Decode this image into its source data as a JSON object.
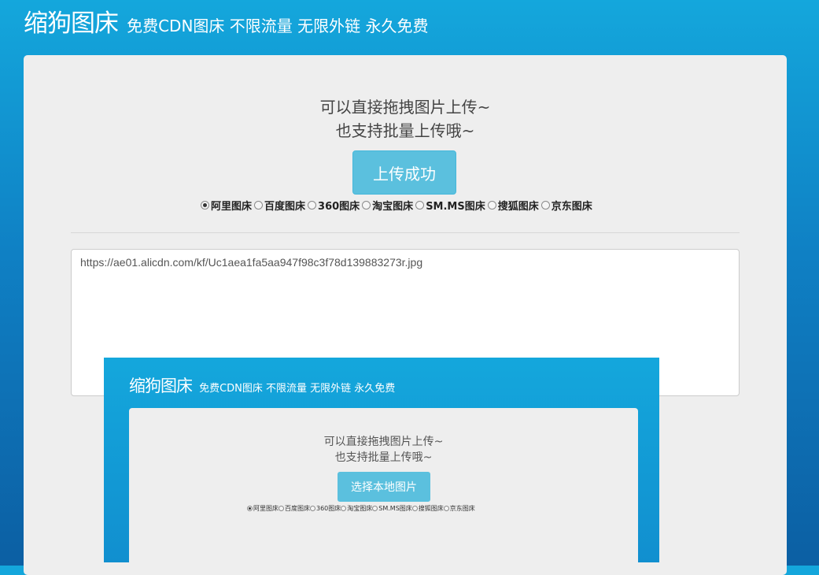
{
  "header": {
    "title": "缩狗图床",
    "subtitle": "免费CDN图床 不限流量 无限外链 永久免费"
  },
  "upload": {
    "hint_line1": "可以直接拖拽图片上传~",
    "hint_line2": "也支持批量上传哦~",
    "button_label": "上传成功"
  },
  "hosts": [
    {
      "label": "阿里图床",
      "checked": true
    },
    {
      "label": "百度图床",
      "checked": false
    },
    {
      "label": "360图床",
      "checked": false
    },
    {
      "label": "淘宝图床",
      "checked": false
    },
    {
      "label": "SM.MS图床",
      "checked": false
    },
    {
      "label": "搜狐图床",
      "checked": false
    },
    {
      "label": "京东图床",
      "checked": false
    }
  ],
  "result": {
    "url": "https://ae01.alicdn.com/kf/Uc1aea1fa5aa947f98c3f78d139883273r.jpg"
  },
  "preview": {
    "title": "缩狗图床",
    "subtitle": "免费CDN图床 不限流量 无限外链 永久免费",
    "hint_line1": "可以直接拖拽图片上传~",
    "hint_line2": "也支持批量上传哦~",
    "button_label": "选择本地图片",
    "hosts": [
      "阿里图床",
      "百度图床",
      "360图床",
      "淘宝图床",
      "SM.MS图床",
      "搜狐图床",
      "京东图床"
    ]
  }
}
